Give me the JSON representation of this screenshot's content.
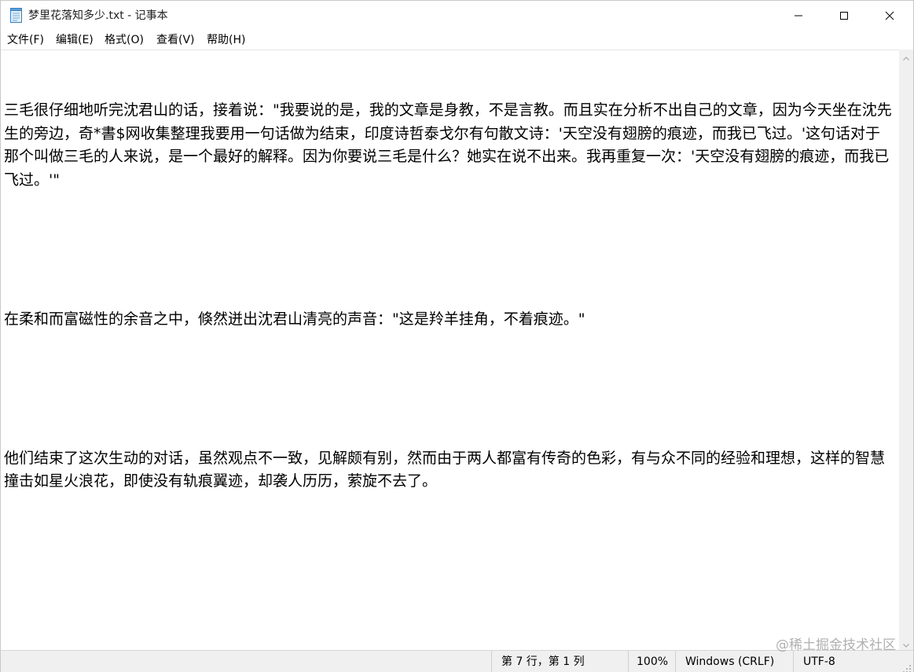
{
  "window": {
    "title": "梦里花落知多少.txt - 记事本"
  },
  "icons": {
    "app": "notepad-icon",
    "minimize": "minimize-icon",
    "maximize": "maximize-icon",
    "close": "close-icon"
  },
  "menu": {
    "file": "文件(F)",
    "edit": "编辑(E)",
    "format": "格式(O)",
    "view": "查看(V)",
    "help": "帮助(H)"
  },
  "document": {
    "paragraphs": [
      "三毛很仔细地听完沈君山的话，接着说：\"我要说的是，我的文章是身教，不是言教。而且实在分析不出自己的文章，因为今天坐在沈先生的旁边，奇*書$网收集整理我要用一句话做为结束，印度诗哲泰戈尔有句散文诗：'天空没有翅膀的痕迹，而我已飞过。'这句话对于那个叫做三毛的人来说，是一个最好的解释。因为你要说三毛是什么？她实在说不出来。我再重复一次：'天空没有翅膀的痕迹，而我已飞过。'\"",
      "",
      "在柔和而富磁性的余音之中，倏然迸出沈君山清亮的声音：\"这是羚羊挂角，不着痕迹。\"",
      "",
      "他们结束了这次生动的对话，虽然观点不一致，见解颇有别，然而由于两人都富有传奇的色彩，有与众不同的经验和理想，这样的智慧撞击如星火浪花，即使没有轨痕翼迹，却袭人历历，萦旋不去了。"
    ]
  },
  "status": {
    "position": "第 7 行，第 1 列",
    "zoom": "100%",
    "line_ending": "Windows (CRLF)",
    "encoding": "UTF-8"
  },
  "watermark": "@稀土掘金技术社区"
}
